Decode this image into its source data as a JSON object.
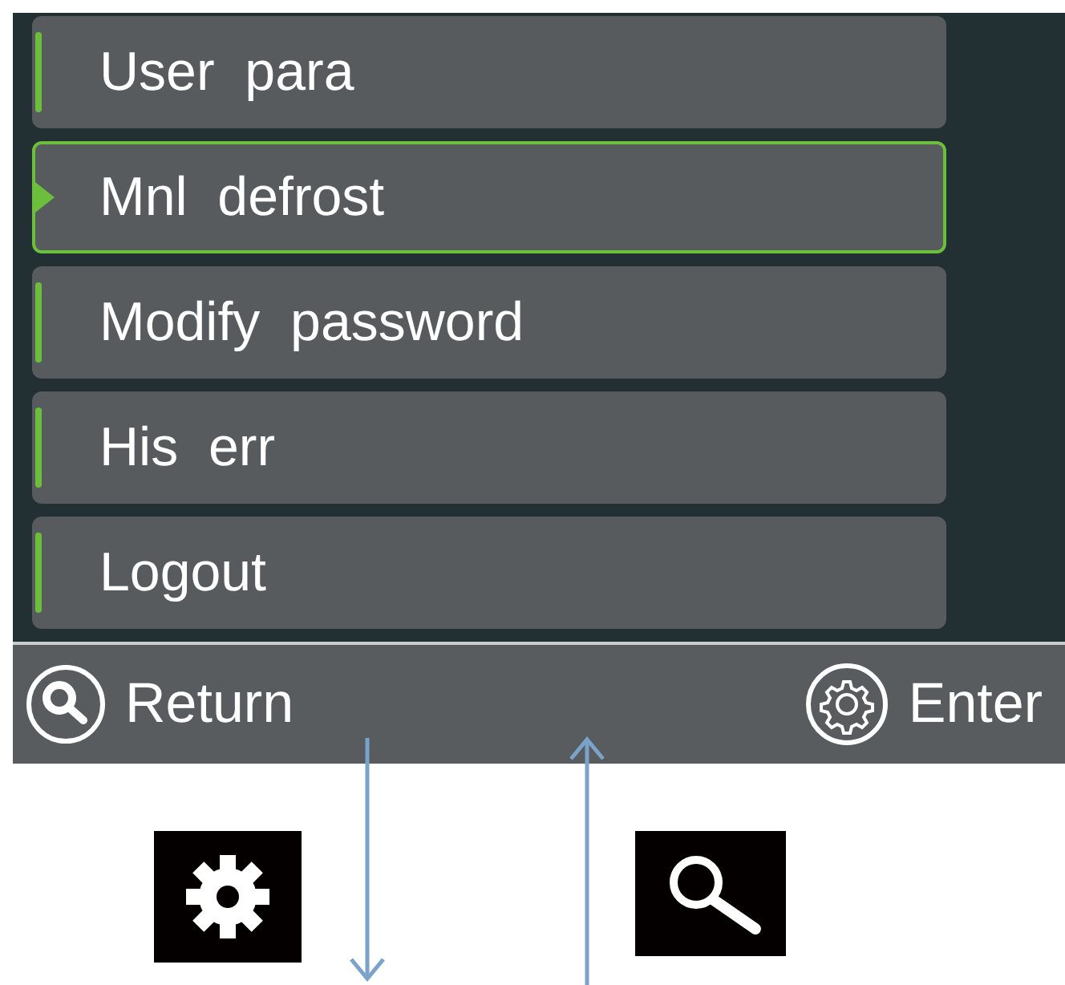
{
  "menu": {
    "items": [
      {
        "label": "User  para",
        "selected": false
      },
      {
        "label": "Mnl  defrost",
        "selected": true
      },
      {
        "label": "Modify  password",
        "selected": false
      },
      {
        "label": "His  err",
        "selected": false
      },
      {
        "label": "Logout",
        "selected": false
      }
    ]
  },
  "bottom_bar": {
    "left": "Return",
    "right": "Enter"
  }
}
